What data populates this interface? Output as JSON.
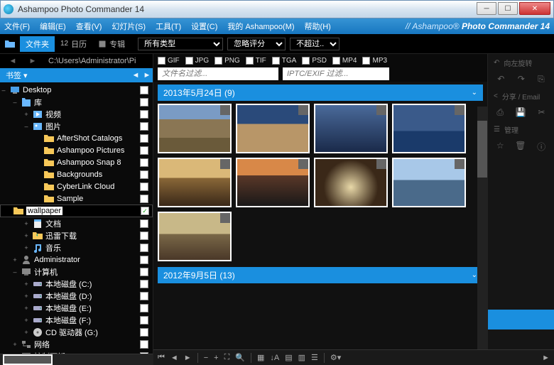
{
  "window": {
    "title": "Ashampoo Photo Commander 14"
  },
  "menu": {
    "items": [
      "文件(F)",
      "编辑(E)",
      "查看(V)",
      "幻灯片(S)",
      "工具(T)",
      "设置(C)",
      "我的 Ashampoo(M)",
      "帮助(H)"
    ],
    "brand_a": "// Ashampoo®",
    "brand_b": "Photo Commander 14"
  },
  "tabs": {
    "folder": "文件夹",
    "calendar": "日历",
    "edit": "专辑"
  },
  "address": "C:\\Users\\Administrator\\Pi",
  "sidebar": {
    "tab": "书签 ▾",
    "tree": [
      {
        "lvl": 0,
        "exp": "–",
        "icon": "desktop",
        "label": "Desktop",
        "chk": false
      },
      {
        "lvl": 1,
        "exp": "–",
        "icon": "lib",
        "label": "库",
        "chk": false
      },
      {
        "lvl": 2,
        "exp": "+",
        "icon": "video",
        "label": "视频",
        "chk": false
      },
      {
        "lvl": 2,
        "exp": "–",
        "icon": "pic",
        "label": "图片",
        "chk": false
      },
      {
        "lvl": 3,
        "exp": "",
        "icon": "folder",
        "label": "AfterShot Catalogs",
        "chk": false
      },
      {
        "lvl": 3,
        "exp": "",
        "icon": "folder",
        "label": "Ashampoo Pictures",
        "chk": false
      },
      {
        "lvl": 3,
        "exp": "",
        "icon": "folder",
        "label": "Ashampoo Snap 8",
        "chk": false
      },
      {
        "lvl": 3,
        "exp": "",
        "icon": "folder",
        "label": "Backgrounds",
        "chk": false
      },
      {
        "lvl": 3,
        "exp": "",
        "icon": "folder",
        "label": "CyberLink Cloud",
        "chk": false
      },
      {
        "lvl": 3,
        "exp": "",
        "icon": "folder",
        "label": "Sample",
        "chk": false
      },
      {
        "lvl": 3,
        "exp": "",
        "icon": "folder",
        "label": "wallpaper",
        "chk": true,
        "sel": true
      },
      {
        "lvl": 2,
        "exp": "+",
        "icon": "doc",
        "label": "文档",
        "chk": false
      },
      {
        "lvl": 2,
        "exp": "+",
        "icon": "dl",
        "label": "迅雷下载",
        "chk": false
      },
      {
        "lvl": 2,
        "exp": "+",
        "icon": "music",
        "label": "音乐",
        "chk": false
      },
      {
        "lvl": 1,
        "exp": "+",
        "icon": "user",
        "label": "Administrator",
        "chk": false
      },
      {
        "lvl": 1,
        "exp": "–",
        "icon": "comp",
        "label": "计算机",
        "chk": false
      },
      {
        "lvl": 2,
        "exp": "+",
        "icon": "drive",
        "label": "本地磁盘 (C:)",
        "chk": false
      },
      {
        "lvl": 2,
        "exp": "+",
        "icon": "drive",
        "label": "本地磁盘 (D:)",
        "chk": false
      },
      {
        "lvl": 2,
        "exp": "+",
        "icon": "drive",
        "label": "本地磁盘 (E:)",
        "chk": false
      },
      {
        "lvl": 2,
        "exp": "+",
        "icon": "drive",
        "label": "本地磁盘 (F:)",
        "chk": false
      },
      {
        "lvl": 2,
        "exp": "+",
        "icon": "cd",
        "label": "CD 驱动器 (G:)",
        "chk": false
      },
      {
        "lvl": 1,
        "exp": "+",
        "icon": "net",
        "label": "网络",
        "chk": false
      },
      {
        "lvl": 1,
        "exp": "+",
        "icon": "cp",
        "label": "控制面板",
        "chk": false
      }
    ]
  },
  "filters": {
    "type": "所有类型",
    "rating": "忽略评分",
    "more": "不超过...",
    "formats": [
      "GIF",
      "JPG",
      "PNG",
      "TIF",
      "TGA",
      "PSD",
      "MP4",
      "MP3"
    ],
    "name_ph": "文件名过滤...",
    "exif_ph": "IPTC/EXIF 过滤..."
  },
  "actions": {
    "rotate": "向左旋转",
    "share": "分享 / Email",
    "manage": "管理"
  },
  "groups": [
    {
      "title": "2013年5月24日 (9)",
      "count": 9,
      "thumbs": [
        {
          "g": "linear-gradient(#7a9bc4 30%, #8a7654 30% 70%, #6a5a3a 70%)"
        },
        {
          "g": "linear-gradient(#2a4a7a 40%, #b89668 40%)"
        },
        {
          "g": "linear-gradient(#4a6a9a, #1a2a4a)"
        },
        {
          "g": "linear-gradient(#3a5a8a 55%, #1a3a6a 55%)"
        },
        {
          "g": "linear-gradient(#dab878 40%, #8a6838 40%, #3a2818)"
        },
        {
          "g": "linear-gradient(#d88848 35%, #5a3828 35%, #1a1818)"
        },
        {
          "g": "radial-gradient(circle at 50% 60%, #e8d8a8, #3a2818 60%)"
        },
        {
          "g": "linear-gradient(#a8c8e8 45%, #4a6a8a 45%)"
        },
        {
          "g": "linear-gradient(#c8b888 45%, #7a6848 45%, #4a3828)"
        }
      ]
    },
    {
      "title": "2012年9月5日 (13)",
      "count": 13,
      "thumbs": []
    }
  ]
}
